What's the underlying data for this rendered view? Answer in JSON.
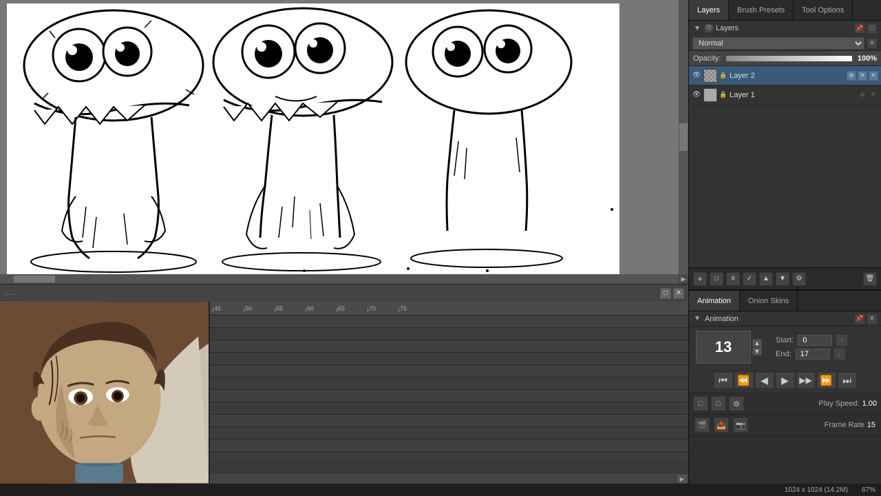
{
  "tabs": {
    "layers_label": "Layers",
    "brush_presets_label": "Brush Presets",
    "tool_options_label": "Tool Options"
  },
  "layers_panel": {
    "title": "Layers",
    "blend_mode": "Normal",
    "opacity_label": "Opacity:",
    "opacity_value": "100%",
    "layers": [
      {
        "name": "Layer 2",
        "active": true,
        "visible": true
      },
      {
        "name": "Layer 1",
        "active": false,
        "visible": true
      }
    ]
  },
  "animation_panel": {
    "tabs": {
      "animation_label": "Animation",
      "onion_skins_label": "Onion Skins"
    },
    "title": "Animation",
    "frame_number": "13",
    "start_label": "Start:",
    "start_value": "0",
    "end_label": "End:",
    "end_value": "17",
    "play_speed_label": "Play Speed:",
    "play_speed_value": "1.00",
    "frame_rate_label": "Frame Rate",
    "frame_rate_value": "15"
  },
  "timeline": {
    "ruler_ticks": [
      "45",
      "50",
      "55",
      "60",
      "65",
      "70",
      "75"
    ],
    "dotted_header": "......"
  },
  "status_bar": {
    "dimensions": "1024 x 1024 (14.2M)",
    "zoom": "67%"
  },
  "playback_buttons": {
    "first_frame": "⏮",
    "prev_keyframe": "⏭",
    "prev_frame": "◀",
    "play": "▶",
    "next_frame_fast": "▶▶",
    "next_keyframe": "⏭",
    "last_frame": "⏭"
  }
}
